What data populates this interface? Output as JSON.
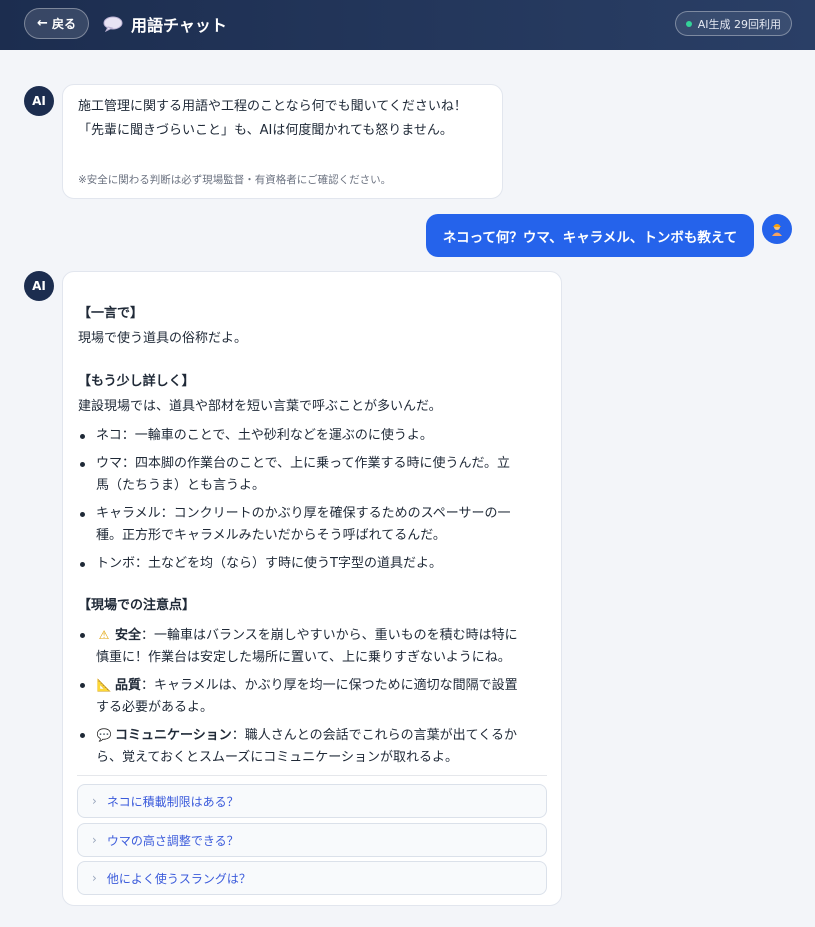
{
  "header": {
    "back_label": "戻る",
    "title": "用語チャット",
    "usage": "AI生成 29回利用"
  },
  "ai_avatar_label": "AI",
  "messages": {
    "intro": {
      "line1": "施工管理に関する用語や工程のことなら何でも聞いてくださいね！",
      "line2": "「先輩に聞きづらいこと」も、AIは何度聞かれても怒りません。",
      "note": "※安全に関わる判断は必ず現場監督・有資格者にご確認ください。"
    },
    "user": {
      "text": "ネコって何？ウマ、キャラメル、トンボも教えて"
    },
    "answer": {
      "h1": "【一言で】",
      "short": "現場で使う道具の俗称だよ。",
      "h2": "【もう少し詳しく】",
      "detail_intro": "建設現場では、道具や部材を短い言葉で呼ぶことが多いんだ。",
      "items": [
        {
          "l1": "ネコ：一輪車のことで、土や砂利などを運ぶのに使うよ。",
          "l2": ""
        },
        {
          "l1": "ウマ：四本脚の作業台のことで、上に乗って作業する時に使うんだ。立",
          "l2": "馬（たちうま）とも言うよ。"
        },
        {
          "l1": "キャラメル：コンクリートのかぶり厚を確保するためのスペーサーの一",
          "l2": "種。正方形でキャラメルみたいだからそう呼ばれてるんだ。"
        },
        {
          "l1": "トンボ：土などを均（なら）す時に使うT字型の道具だよ。",
          "l2": ""
        }
      ],
      "h3": "【現場での注意点】",
      "notes": [
        {
          "icon": "warning-icon",
          "glyph": "⚠",
          "label": "安全",
          "l1": "：一輪車はバランスを崩しやすいから、重いものを積む時は特に",
          "l2": "慎重に！作業台は安定した場所に置いて、上に乗りすぎないようにね。"
        },
        {
          "icon": "triangle-ruler-icon",
          "glyph": "📐",
          "label": "品質",
          "l1": "：キャラメルは、かぶり厚を均一に保つために適切な間隔で設置",
          "l2": "する必要があるよ。"
        },
        {
          "icon": "speech-bubble-icon",
          "glyph": "💬",
          "label": "コミュニケーション",
          "l1": "：職人さんとの会話でこれらの言葉が出てくるか",
          "l2": "ら、覚えておくとスムーズにコミュニケーションが取れるよ。"
        }
      ],
      "suggestions": [
        "ネコに積載制限はある？",
        "ウマの高さ調整できる？",
        "他によく使うスラングは？"
      ]
    }
  },
  "colors": {
    "header": "#1c2d4f",
    "user_bubble": "#2563eb",
    "status_dot": "#34d399",
    "suggestion_text": "#3b5bdb"
  }
}
